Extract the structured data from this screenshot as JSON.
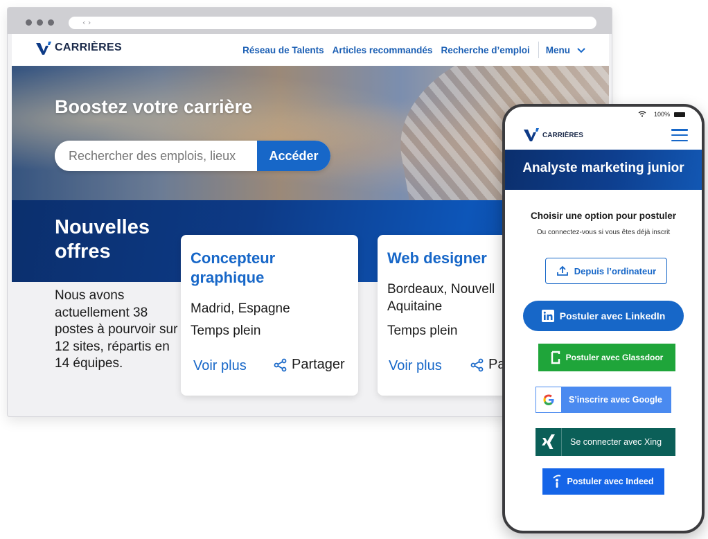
{
  "browser": {
    "address_glyph": "‹ ›",
    "header": {
      "brand": "CARRIÈRES",
      "nav": [
        "Réseau de Talents",
        "Articles recommandés",
        "Recherche d’emploi"
      ],
      "menu_label": "Menu"
    },
    "hero": {
      "title": "Boostez votre carrière",
      "search_placeholder": "Rechercher des emplois, lieux",
      "search_button": "Accéder"
    },
    "offers": {
      "title": "Nouvelles offres",
      "intro": "Nous avons actuellement 38 postes à pourvoir sur 12 sites, répartis en 14 équipes.",
      "jobs": [
        {
          "title": "Concepteur graphique",
          "location": "Madrid, Espagne",
          "type": "Temps plein",
          "more": "Voir plus",
          "share": "Partager"
        },
        {
          "title": "Web designer",
          "location": "Bordeaux, Nouvell Aquitaine",
          "type": "Temps plein",
          "more": "Voir plus",
          "share": "Pa"
        }
      ]
    }
  },
  "phone": {
    "battery": "100%",
    "brand": "CARRIÈRES",
    "job_title": "Analyste marketing junior",
    "choose": "Choisir une option pour postuler",
    "subtext": "Ou connectez-vous si vous êtes déjà inscrit",
    "buttons": {
      "computer": "Depuis l’ordinateur",
      "linkedin": "Postuler avec LinkedIn",
      "glassdoor": "Postuler avec Glassdoor",
      "google": "S’inscrire avec Google",
      "xing": "Se connecter avec Xing",
      "indeed": "Postuler avec Indeed"
    }
  },
  "colors": {
    "brand_blue": "#1767c8",
    "navy": "#0b2f6d",
    "linkedin": "#1767c8",
    "glassdoor": "#1fa53a",
    "google": "#4a8af0",
    "xing": "#0b5f58",
    "indeed": "#1565e8"
  },
  "icons": [
    "logo-v-icon",
    "chevron-down-icon",
    "share-icon",
    "wifi-icon",
    "battery-icon",
    "hamburger-icon",
    "upload-icon",
    "linkedin-icon",
    "glassdoor-icon",
    "google-icon",
    "xing-icon",
    "indeed-icon"
  ]
}
